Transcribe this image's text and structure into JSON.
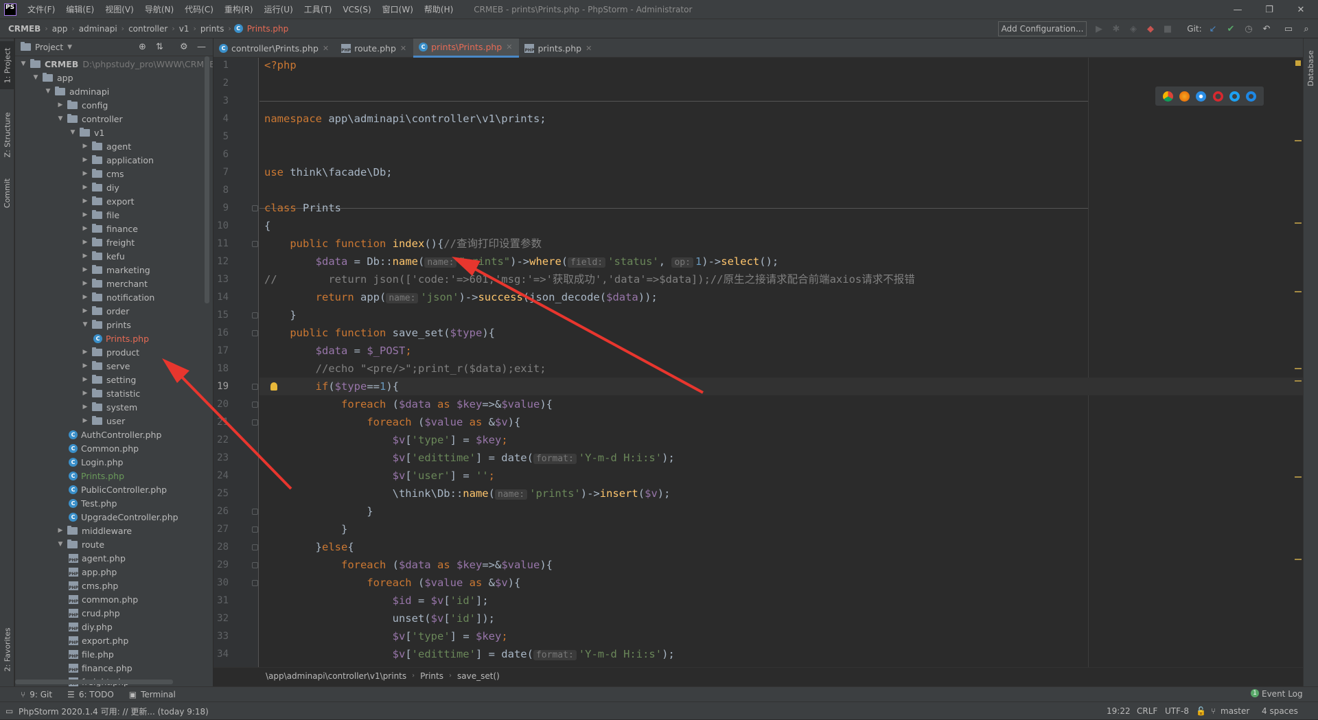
{
  "titlebar": {
    "logo": "PS",
    "menu": [
      "文件(F)",
      "编辑(E)",
      "视图(V)",
      "导航(N)",
      "代码(C)",
      "重构(R)",
      "运行(U)",
      "工具(T)",
      "VCS(S)",
      "窗口(W)",
      "帮助(H)"
    ],
    "window_title": "CRMEB - prints\\Prints.php - PhpStorm - Administrator"
  },
  "navbar": {
    "crumbs": [
      "CRMEB",
      "app",
      "adminapi",
      "controller",
      "v1",
      "prints",
      "Prints.php"
    ],
    "add_configuration": "Add Configuration...",
    "git_label": "Git:"
  },
  "left_strip": {
    "project": "1: Project",
    "structure": "Z: Structure",
    "commit": "Commit",
    "favorites": "2: Favorites"
  },
  "right_strip": {
    "database": "Database"
  },
  "project_panel": {
    "title": "Project",
    "root_name": "CRMEB",
    "root_path": "D:\\phpstudy_pro\\WWW\\CRMEB\\C",
    "tree": [
      {
        "label": "app",
        "depth": 1,
        "type": "folder",
        "open": true
      },
      {
        "label": "adminapi",
        "depth": 2,
        "type": "folder",
        "open": true
      },
      {
        "label": "config",
        "depth": 3,
        "type": "folder",
        "open": false
      },
      {
        "label": "controller",
        "depth": 3,
        "type": "folder",
        "open": true
      },
      {
        "label": "v1",
        "depth": 4,
        "type": "folder",
        "open": true
      },
      {
        "label": "agent",
        "depth": 5,
        "type": "folder",
        "open": false
      },
      {
        "label": "application",
        "depth": 5,
        "type": "folder",
        "open": false
      },
      {
        "label": "cms",
        "depth": 5,
        "type": "folder",
        "open": false
      },
      {
        "label": "diy",
        "depth": 5,
        "type": "folder",
        "open": false
      },
      {
        "label": "export",
        "depth": 5,
        "type": "folder",
        "open": false
      },
      {
        "label": "file",
        "depth": 5,
        "type": "folder",
        "open": false
      },
      {
        "label": "finance",
        "depth": 5,
        "type": "folder",
        "open": false
      },
      {
        "label": "freight",
        "depth": 5,
        "type": "folder",
        "open": false
      },
      {
        "label": "kefu",
        "depth": 5,
        "type": "folder",
        "open": false
      },
      {
        "label": "marketing",
        "depth": 5,
        "type": "folder",
        "open": false
      },
      {
        "label": "merchant",
        "depth": 5,
        "type": "folder",
        "open": false
      },
      {
        "label": "notification",
        "depth": 5,
        "type": "folder",
        "open": false
      },
      {
        "label": "order",
        "depth": 5,
        "type": "folder",
        "open": false
      },
      {
        "label": "prints",
        "depth": 5,
        "type": "folder",
        "open": true
      },
      {
        "label": "Prints.php",
        "depth": 6,
        "type": "class",
        "state": "selected"
      },
      {
        "label": "product",
        "depth": 5,
        "type": "folder",
        "open": false
      },
      {
        "label": "serve",
        "depth": 5,
        "type": "folder",
        "open": false
      },
      {
        "label": "setting",
        "depth": 5,
        "type": "folder",
        "open": false
      },
      {
        "label": "statistic",
        "depth": 5,
        "type": "folder",
        "open": false
      },
      {
        "label": "system",
        "depth": 5,
        "type": "folder",
        "open": false
      },
      {
        "label": "user",
        "depth": 5,
        "type": "folder",
        "open": false
      },
      {
        "label": "AuthController.php",
        "depth": 4,
        "type": "class"
      },
      {
        "label": "Common.php",
        "depth": 4,
        "type": "class"
      },
      {
        "label": "Login.php",
        "depth": 4,
        "type": "class"
      },
      {
        "label": "Prints.php",
        "depth": 4,
        "type": "class",
        "state": "new"
      },
      {
        "label": "PublicController.php",
        "depth": 4,
        "type": "class"
      },
      {
        "label": "Test.php",
        "depth": 4,
        "type": "class"
      },
      {
        "label": "UpgradeController.php",
        "depth": 4,
        "type": "class"
      },
      {
        "label": "middleware",
        "depth": 3,
        "type": "folder",
        "open": false
      },
      {
        "label": "route",
        "depth": 3,
        "type": "folder",
        "open": true
      },
      {
        "label": "agent.php",
        "depth": 4,
        "type": "php"
      },
      {
        "label": "app.php",
        "depth": 4,
        "type": "php"
      },
      {
        "label": "cms.php",
        "depth": 4,
        "type": "php"
      },
      {
        "label": "common.php",
        "depth": 4,
        "type": "php"
      },
      {
        "label": "crud.php",
        "depth": 4,
        "type": "php"
      },
      {
        "label": "diy.php",
        "depth": 4,
        "type": "php"
      },
      {
        "label": "export.php",
        "depth": 4,
        "type": "php"
      },
      {
        "label": "file.php",
        "depth": 4,
        "type": "php"
      },
      {
        "label": "finance.php",
        "depth": 4,
        "type": "php"
      },
      {
        "label": "freight.php",
        "depth": 4,
        "type": "php"
      }
    ]
  },
  "tabs": [
    {
      "label": "controller\\Prints.php",
      "icon": "class",
      "active": false
    },
    {
      "label": "route.php",
      "icon": "php",
      "active": false
    },
    {
      "label": "prints\\Prints.php",
      "icon": "class",
      "active": true
    },
    {
      "label": "prints.php",
      "icon": "php",
      "active": false
    }
  ],
  "code_lines": [
    [
      [
        "kw",
        "<?php"
      ]
    ],
    [],
    [],
    [
      [
        "kw",
        "namespace "
      ],
      [
        "cls",
        "app\\adminapi\\controller\\v1\\prints;"
      ]
    ],
    [],
    [],
    [
      [
        "kw",
        "use "
      ],
      [
        "cls",
        "think\\facade\\Db;"
      ]
    ],
    [],
    [
      [
        "kw",
        "class "
      ],
      [
        "cls",
        "Prints"
      ]
    ],
    [
      [
        "cls",
        "{"
      ]
    ],
    [
      [
        "cls",
        "    "
      ],
      [
        "kw",
        "public function "
      ],
      [
        "fn",
        "index"
      ],
      [
        "cls",
        "(){"
      ],
      [
        "cm",
        "//查询打印设置参数"
      ]
    ],
    [
      [
        "cls",
        "        "
      ],
      [
        "var",
        "$data"
      ],
      [
        "cls",
        " = Db::"
      ],
      [
        "fn",
        "name"
      ],
      [
        "cls",
        "("
      ],
      [
        "hint",
        "name:"
      ],
      [
        "str",
        "\"prints\""
      ],
      [
        "cls",
        ")->"
      ],
      [
        "fn",
        "where"
      ],
      [
        "cls",
        "("
      ],
      [
        "hint",
        "field:"
      ],
      [
        "str",
        "'status'"
      ],
      [
        "cls",
        ", "
      ],
      [
        "hint",
        "op:"
      ],
      [
        "num",
        "1"
      ],
      [
        "cls",
        ")->"
      ],
      [
        "fn",
        "select"
      ],
      [
        "cls",
        "();"
      ]
    ],
    [
      [
        "cm",
        "//        return json(['code:'=>601,'msg:'=>'获取成功','data'=>$data]);//原生之接请求配合前端axios请求不报错"
      ]
    ],
    [
      [
        "cls",
        "        "
      ],
      [
        "kw",
        "return "
      ],
      [
        "cls",
        "app("
      ],
      [
        "hint",
        "name:"
      ],
      [
        "str",
        "'json'"
      ],
      [
        "cls",
        ")->"
      ],
      [
        "fn",
        "success"
      ],
      [
        "cls",
        "(json_decode("
      ],
      [
        "var",
        "$data"
      ],
      [
        "cls",
        "));"
      ]
    ],
    [
      [
        "cls",
        "    }"
      ]
    ],
    [
      [
        "cls",
        "    "
      ],
      [
        "kw",
        "public function "
      ],
      [
        "cls",
        "save_set("
      ],
      [
        "var",
        "$type"
      ],
      [
        "cls",
        "){"
      ]
    ],
    [
      [
        "cls",
        "        "
      ],
      [
        "var",
        "$data"
      ],
      [
        "cls",
        " = "
      ],
      [
        "var",
        "$_POST"
      ],
      [
        "kw",
        ";"
      ]
    ],
    [
      [
        "cls",
        "        "
      ],
      [
        "cm",
        "//echo \"<pre/>\";print_r($data);exit;"
      ]
    ],
    [
      [
        "cls",
        "        "
      ],
      [
        "kw",
        "if"
      ],
      [
        "cls",
        "("
      ],
      [
        "var",
        "$type"
      ],
      [
        "cls",
        "=="
      ],
      [
        "num",
        "1"
      ],
      [
        "cls",
        "){"
      ]
    ],
    [
      [
        "cls",
        "            "
      ],
      [
        "kw",
        "foreach "
      ],
      [
        "cls",
        "("
      ],
      [
        "var",
        "$data"
      ],
      [
        "kw",
        " as "
      ],
      [
        "var",
        "$key"
      ],
      [
        "cls",
        "=>&"
      ],
      [
        "var",
        "$value"
      ],
      [
        "cls",
        "){"
      ]
    ],
    [
      [
        "cls",
        "                "
      ],
      [
        "kw",
        "foreach "
      ],
      [
        "cls",
        "("
      ],
      [
        "var",
        "$value"
      ],
      [
        "kw",
        " as "
      ],
      [
        "cls",
        "&"
      ],
      [
        "var",
        "$v"
      ],
      [
        "cls",
        "){"
      ]
    ],
    [
      [
        "cls",
        "                    "
      ],
      [
        "var",
        "$v"
      ],
      [
        "cls",
        "["
      ],
      [
        "str",
        "'type'"
      ],
      [
        "cls",
        "] = "
      ],
      [
        "var",
        "$key"
      ],
      [
        "kw",
        ";"
      ]
    ],
    [
      [
        "cls",
        "                    "
      ],
      [
        "var",
        "$v"
      ],
      [
        "cls",
        "["
      ],
      [
        "str",
        "'edittime'"
      ],
      [
        "cls",
        "] = date("
      ],
      [
        "hint",
        "format:"
      ],
      [
        "str",
        "'Y-m-d H:i:s'"
      ],
      [
        "cls",
        ");"
      ]
    ],
    [
      [
        "cls",
        "                    "
      ],
      [
        "var",
        "$v"
      ],
      [
        "cls",
        "["
      ],
      [
        "str",
        "'user'"
      ],
      [
        "cls",
        "] = "
      ],
      [
        "str",
        "''"
      ],
      [
        "kw",
        ";"
      ]
    ],
    [
      [
        "cls",
        "                    \\think\\Db::"
      ],
      [
        "fn",
        "name"
      ],
      [
        "cls",
        "("
      ],
      [
        "hint",
        "name:"
      ],
      [
        "str",
        "'prints'"
      ],
      [
        "cls",
        ")->"
      ],
      [
        "fn",
        "insert"
      ],
      [
        "cls",
        "("
      ],
      [
        "var",
        "$v"
      ],
      [
        "cls",
        ");"
      ]
    ],
    [
      [
        "cls",
        "                }"
      ]
    ],
    [
      [
        "cls",
        "            }"
      ]
    ],
    [
      [
        "cls",
        "        }"
      ],
      [
        "kw",
        "else"
      ],
      [
        "cls",
        "{"
      ]
    ],
    [
      [
        "cls",
        "            "
      ],
      [
        "kw",
        "foreach "
      ],
      [
        "cls",
        "("
      ],
      [
        "var",
        "$data"
      ],
      [
        "kw",
        " as "
      ],
      [
        "var",
        "$key"
      ],
      [
        "cls",
        "=>&"
      ],
      [
        "var",
        "$value"
      ],
      [
        "cls",
        "){"
      ]
    ],
    [
      [
        "cls",
        "                "
      ],
      [
        "kw",
        "foreach "
      ],
      [
        "cls",
        "("
      ],
      [
        "var",
        "$value"
      ],
      [
        "kw",
        " as "
      ],
      [
        "cls",
        "&"
      ],
      [
        "var",
        "$v"
      ],
      [
        "cls",
        "){"
      ]
    ],
    [
      [
        "cls",
        "                    "
      ],
      [
        "var",
        "$id"
      ],
      [
        "cls",
        " = "
      ],
      [
        "var",
        "$v"
      ],
      [
        "cls",
        "["
      ],
      [
        "str",
        "'id'"
      ],
      [
        "cls",
        "];"
      ]
    ],
    [
      [
        "cls",
        "                    unset("
      ],
      [
        "var",
        "$v"
      ],
      [
        "cls",
        "["
      ],
      [
        "str",
        "'id'"
      ],
      [
        "cls",
        "]);"
      ]
    ],
    [
      [
        "cls",
        "                    "
      ],
      [
        "var",
        "$v"
      ],
      [
        "cls",
        "["
      ],
      [
        "str",
        "'type'"
      ],
      [
        "cls",
        "] = "
      ],
      [
        "var",
        "$key"
      ],
      [
        "kw",
        ";"
      ]
    ],
    [
      [
        "cls",
        "                    "
      ],
      [
        "var",
        "$v"
      ],
      [
        "cls",
        "["
      ],
      [
        "str",
        "'edittime'"
      ],
      [
        "cls",
        "] = date("
      ],
      [
        "hint",
        "format:"
      ],
      [
        "str",
        "'Y-m-d H:i:s'"
      ],
      [
        "cls",
        ");"
      ]
    ]
  ],
  "current_line": 19,
  "editor_breadcrumb": [
    "\\app\\adminapi\\controller\\v1\\prints",
    "Prints",
    "save_set()"
  ],
  "bottom_tools": {
    "git": "9: Git",
    "todo": "6: TODO",
    "terminal": "Terminal",
    "event_log": "Event Log"
  },
  "status": {
    "message": "PhpStorm 2020.1.4 可用: // 更新... (today 9:18)",
    "position": "19:22",
    "line_sep": "CRLF",
    "encoding": "UTF-8",
    "branch": "master",
    "indent": "4 spaces"
  },
  "colors": {
    "accent": "#4a88c7",
    "selected_file": "#e86b55",
    "new_file": "#6a9a5a",
    "arrow": "#e8362e"
  }
}
